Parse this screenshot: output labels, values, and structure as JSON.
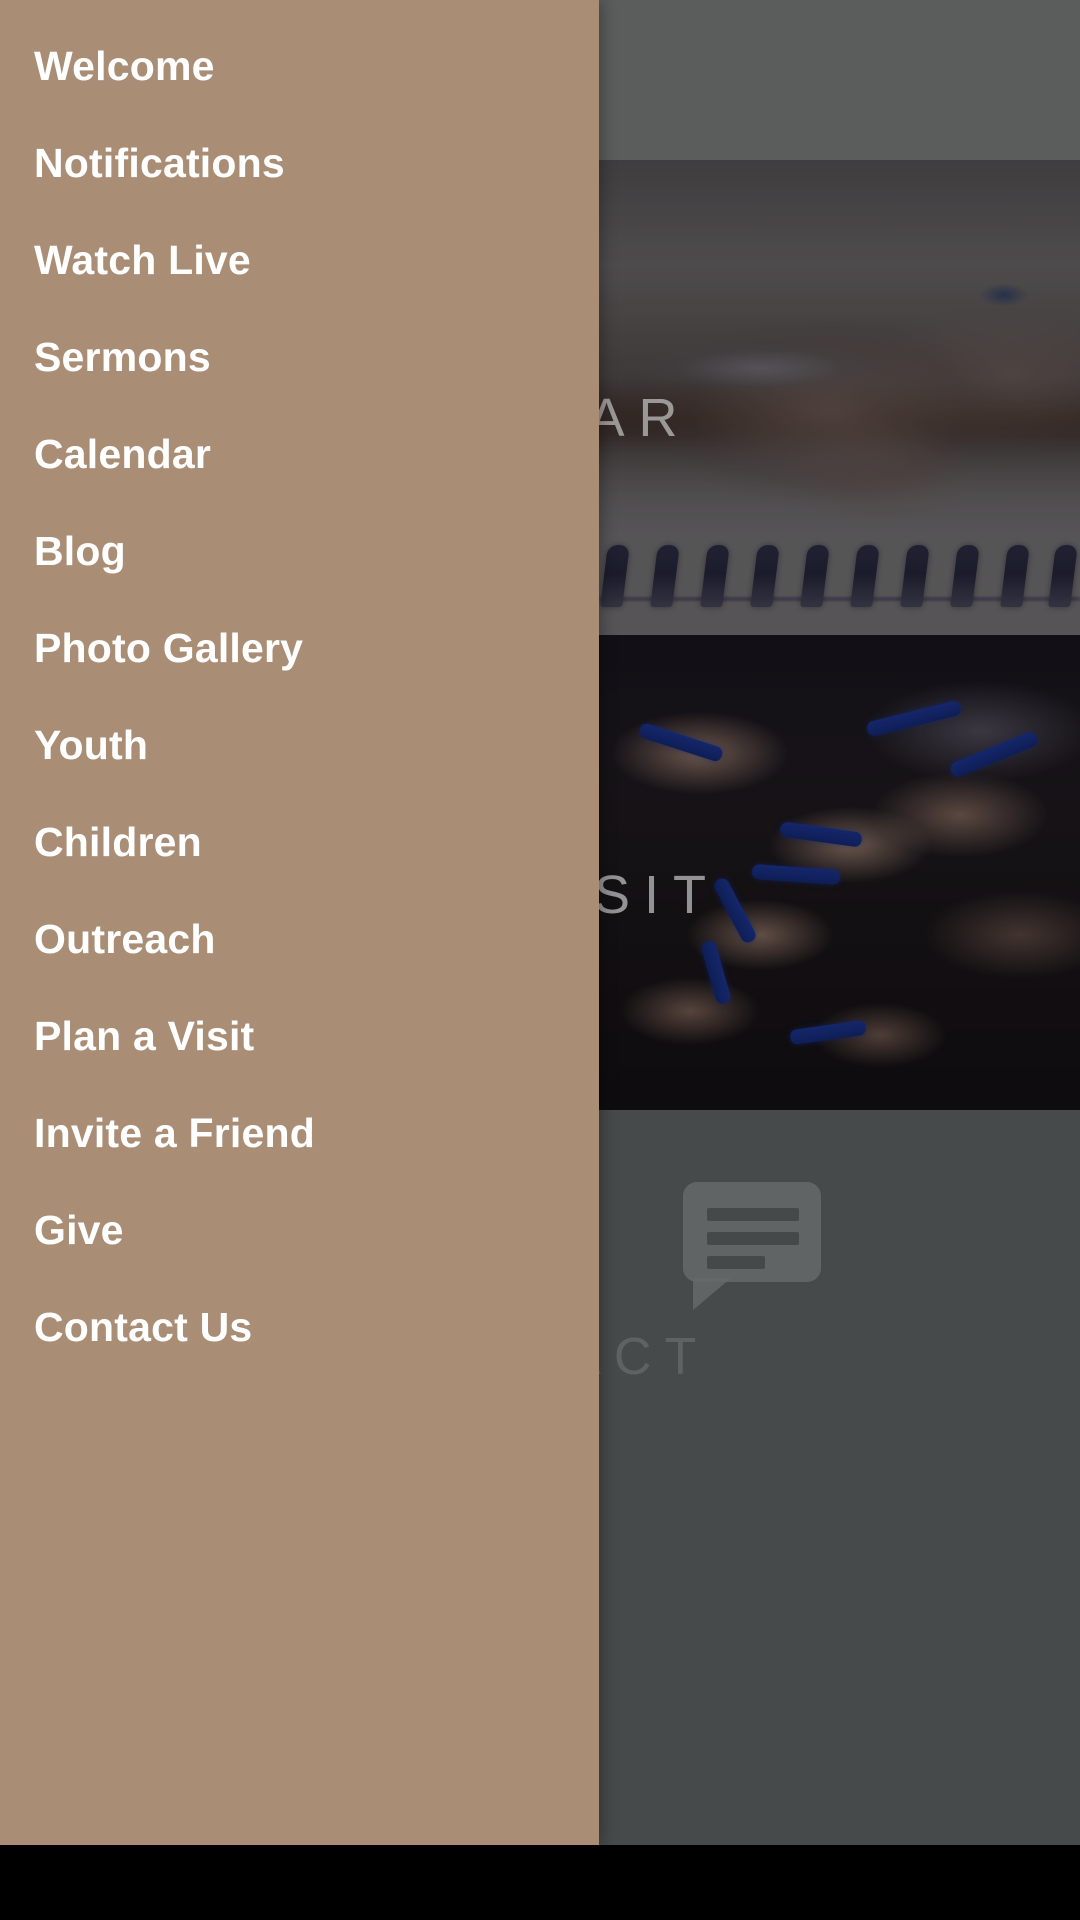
{
  "app": {
    "drawer_background": "#a98d75",
    "drawer_text_color": "#ffffff",
    "scrim_color": "rgba(0,0,0,0.18)",
    "system_bar_color": "#000000"
  },
  "drawer": {
    "items": [
      {
        "label": "Welcome"
      },
      {
        "label": "Notifications"
      },
      {
        "label": "Watch Live"
      },
      {
        "label": "Sermons"
      },
      {
        "label": "Calendar"
      },
      {
        "label": "Blog"
      },
      {
        "label": "Photo Gallery"
      },
      {
        "label": "Youth"
      },
      {
        "label": "Children"
      },
      {
        "label": "Outreach"
      },
      {
        "label": "Plan a Visit"
      },
      {
        "label": "Invite a Friend"
      },
      {
        "label": "Give"
      },
      {
        "label": "Contact Us"
      }
    ]
  },
  "background": {
    "tiles": [
      {
        "name": "top-partial",
        "label": "",
        "visible_label": ""
      },
      {
        "name": "calendar",
        "label": "CALENDAR",
        "visible_label": "LENDAR"
      },
      {
        "name": "plan-a-visit",
        "label": "PLAN A VISIT",
        "visible_label": "N A VISIT"
      },
      {
        "name": "contact-us",
        "label": "CONTACT US",
        "visible_label": "CONTACT\nUS"
      }
    ]
  }
}
